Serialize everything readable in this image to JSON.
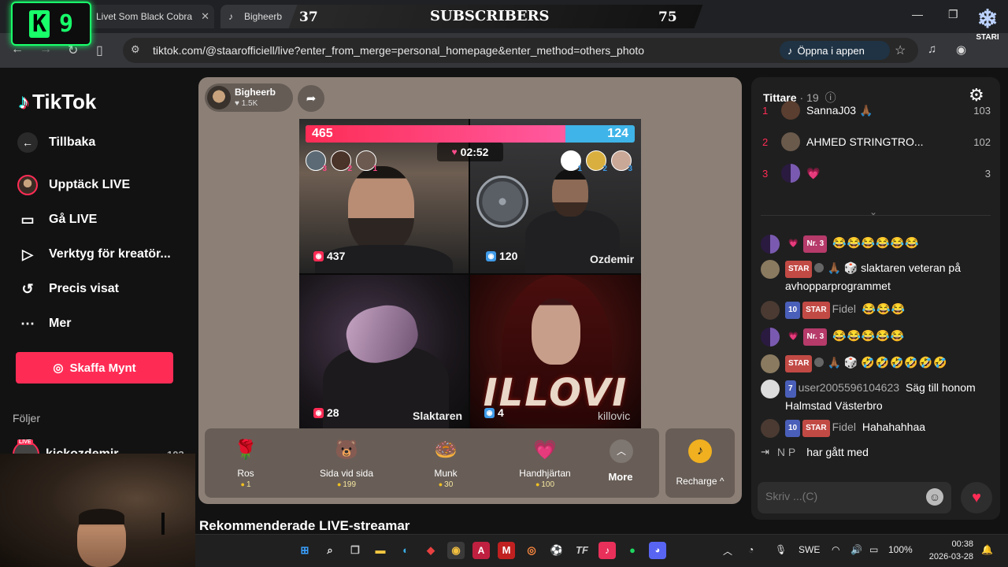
{
  "browser": {
    "tabs": [
      {
        "title": "Livet Som Black Cobra"
      },
      {
        "title": "Bigheerb"
      }
    ],
    "url": "tiktok.com/@staarofficiell/live?enter_from_merge=personal_homepage&enter_method=others_photo",
    "open_in_app": "Öppna i appen"
  },
  "overlay": {
    "k_letter": "K",
    "k_number": "9",
    "left_count": "37",
    "label": "SUBSCRIBERS",
    "right_count": "75",
    "stari_label": "STARI"
  },
  "sidebar": {
    "logo": "TikTok",
    "back": "Tillbaka",
    "items": [
      {
        "label": "Upptäck LIVE"
      },
      {
        "label": "Gå LIVE"
      },
      {
        "label": "Verktyg för kreatör..."
      },
      {
        "label": "Precis visat"
      },
      {
        "label": "Mer"
      }
    ],
    "coins_button": "Skaffa Mynt",
    "following_title": "Följer",
    "following": [
      {
        "name": "kickozdemir",
        "count": "103"
      }
    ]
  },
  "live": {
    "host_name": "Bigheerb",
    "host_likes": "1.5K",
    "score_left": "465",
    "score_right": "124",
    "score_left_fraction": 0.789,
    "timer": "02:52",
    "cells": [
      {
        "score": "437",
        "name": ""
      },
      {
        "score": "120",
        "name": "Ozdemir"
      },
      {
        "score": "28",
        "name": "Slaktaren"
      },
      {
        "score": "4",
        "name": "killovic"
      }
    ],
    "left_ranks": [
      "3",
      "2",
      "1"
    ],
    "right_ranks": [
      "1",
      "2",
      "3"
    ],
    "art_text": "ILLOVI",
    "gifts": [
      {
        "name": "Ros",
        "price": "1",
        "icon": "rose-icon"
      },
      {
        "name": "Sida vid sida",
        "price": "199",
        "icon": "friends-icon"
      },
      {
        "name": "Munk",
        "price": "30",
        "icon": "donut-icon"
      },
      {
        "name": "Handhjärtan",
        "price": "100",
        "icon": "hand-heart-icon"
      }
    ],
    "more": "More",
    "recharge": "Recharge"
  },
  "recommended_title": "Rekommenderade LIVE-streamar",
  "viewers": {
    "title": "Tittare",
    "count": "· 19",
    "list": [
      {
        "rank": "1",
        "name": "SannaJ03 🙏🏾",
        "score": "103"
      },
      {
        "rank": "2",
        "name": "AHMED STRINGTRO...",
        "score": "102"
      },
      {
        "rank": "3",
        "name": "💗",
        "score": "3"
      }
    ]
  },
  "chat": {
    "messages": [
      {
        "badges": [
          "💗",
          "Nr. 3"
        ],
        "user": "",
        "text": "😂😂😂😂😂😂"
      },
      {
        "badges": [
          "STAR",
          "🙏🏾",
          "🎲"
        ],
        "user": "",
        "text": "slaktaren veteran på avhopparprogrammet"
      },
      {
        "badges": [
          "10",
          "STAR"
        ],
        "user": "Fidel",
        "text": "😂😂😂"
      },
      {
        "badges": [
          "💗",
          "Nr. 3"
        ],
        "user": "",
        "text": "😂😂😂😂😂"
      },
      {
        "badges": [
          "STAR",
          "🙏🏾",
          "🎲"
        ],
        "user": "",
        "text": "🤣🤣🤣🤣🤣🤣"
      },
      {
        "badges": [
          "7"
        ],
        "user": "user2005596104623",
        "text": "Säg till honom Halmstad Västerbro"
      },
      {
        "badges": [
          "10",
          "STAR"
        ],
        "user": "Fidel",
        "text": "Hahahahhaa"
      }
    ],
    "joined_user": "N P",
    "joined_text": "har gått med",
    "input_placeholder": "Skriv ...(C)"
  },
  "taskbar": {
    "lang": "SWE",
    "battery": "100%",
    "time": "00:38",
    "date": "2026-03-28"
  }
}
